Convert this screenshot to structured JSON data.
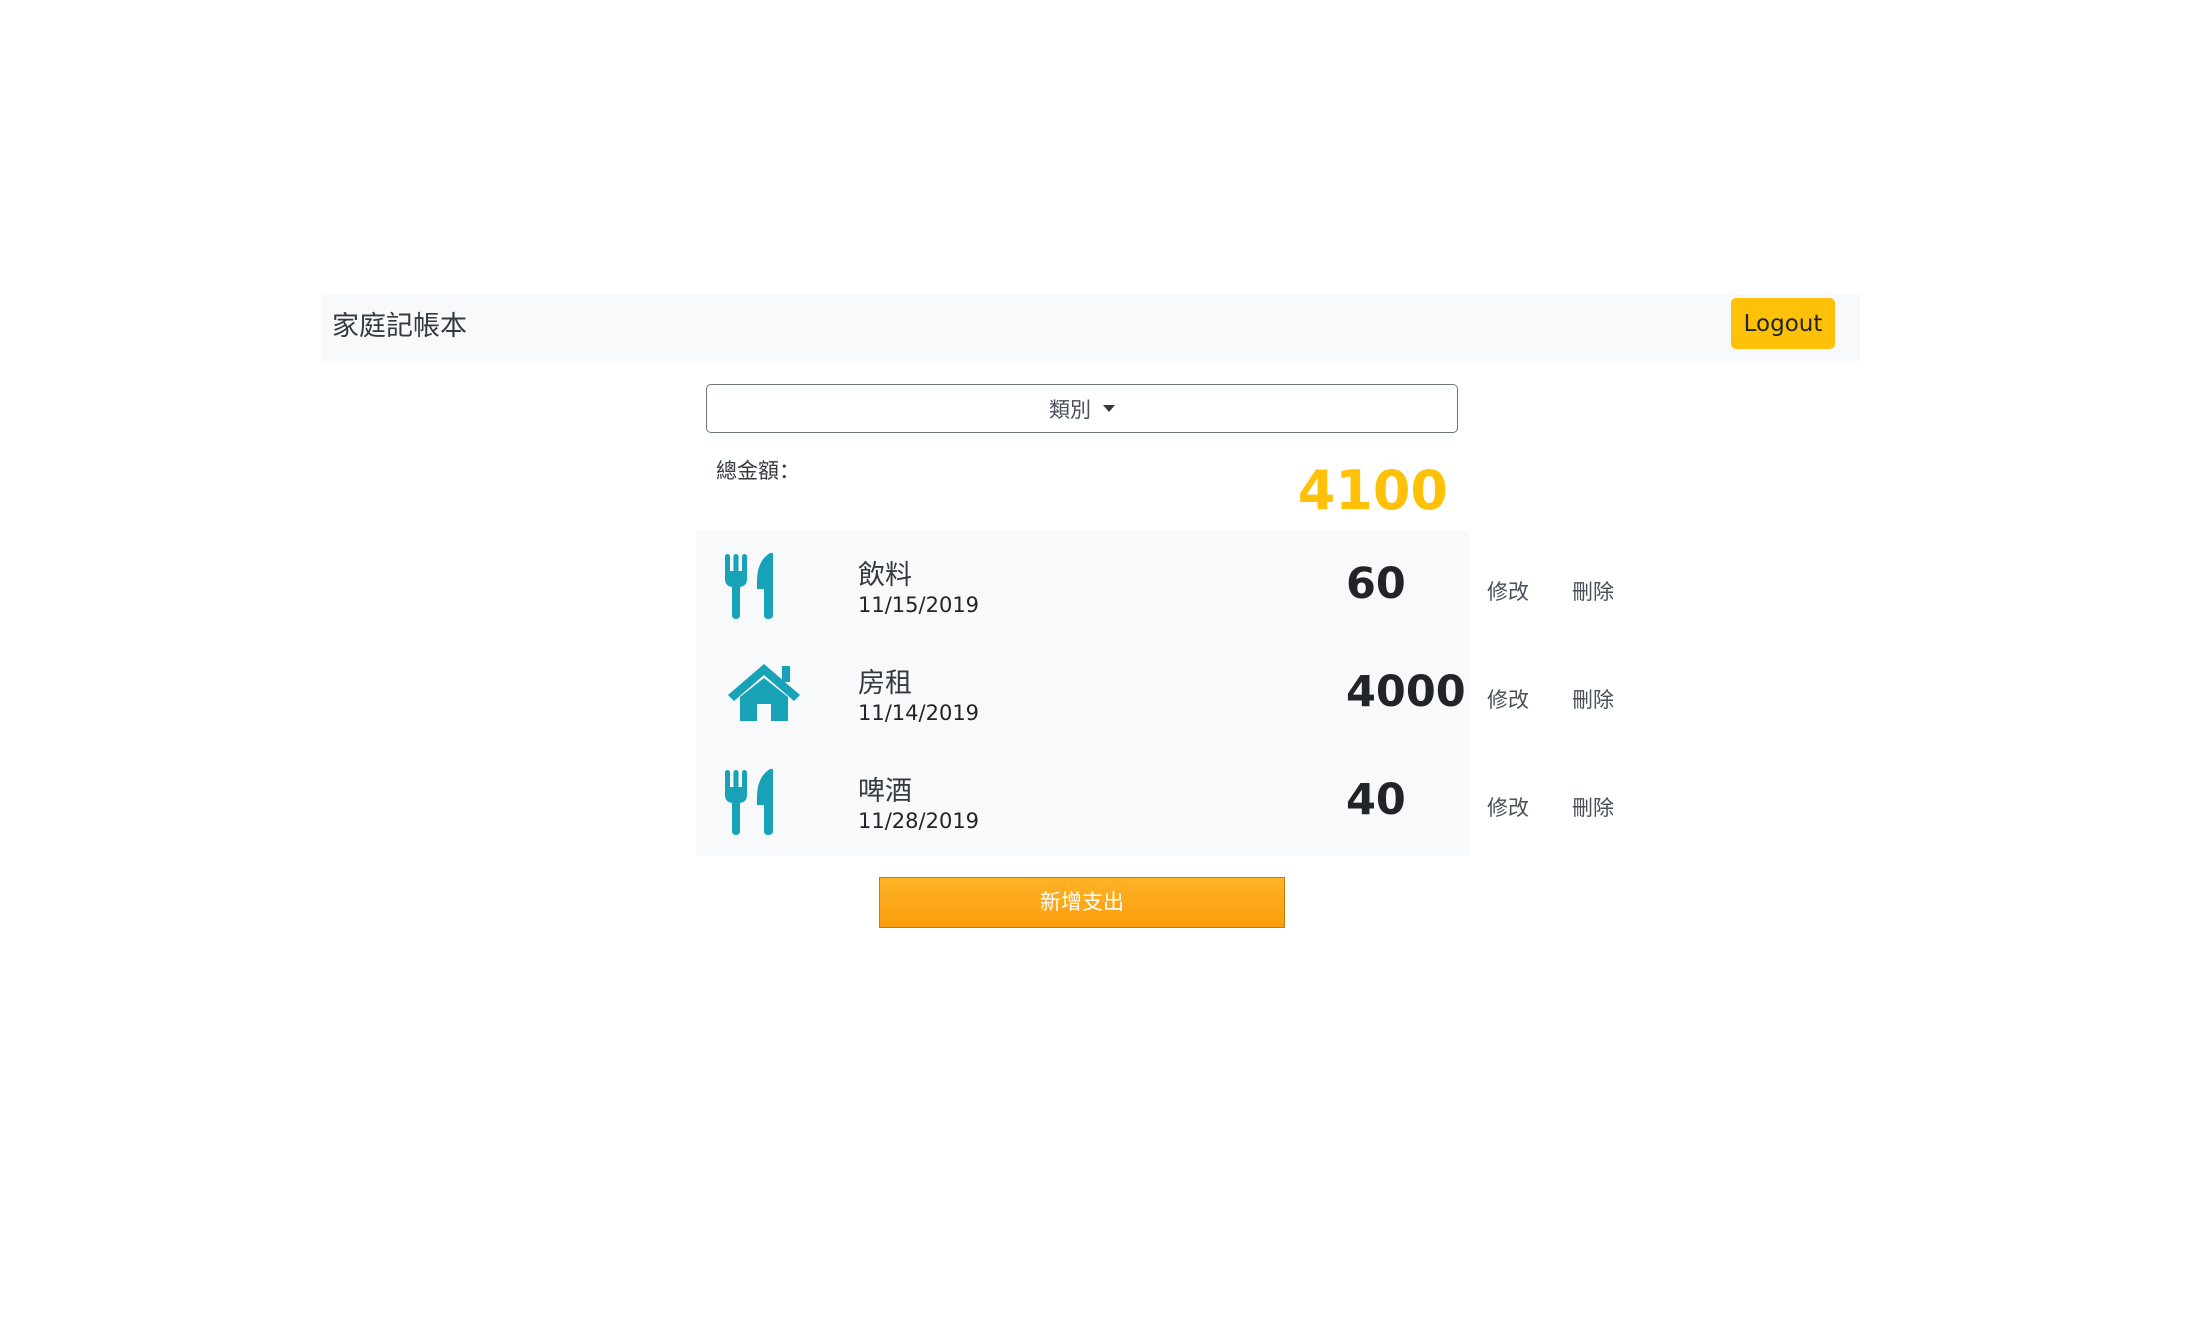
{
  "app": {
    "title": "家庭記帳本",
    "logout_label": "Logout"
  },
  "filter": {
    "category_label": "類別"
  },
  "summary": {
    "total_label": "總金額：",
    "total_amount": "4100"
  },
  "expenses": [
    {
      "icon": "utensils-icon",
      "title": "飲料",
      "date": "11/15/2019",
      "amount": "60",
      "edit_label": "修改",
      "delete_label": "刪除"
    },
    {
      "icon": "home-icon",
      "title": "房租",
      "date": "11/14/2019",
      "amount": "4000",
      "edit_label": "修改",
      "delete_label": "刪除"
    },
    {
      "icon": "utensils-icon",
      "title": "啤酒",
      "date": "11/28/2019",
      "amount": "40",
      "edit_label": "修改",
      "delete_label": "刪除"
    }
  ],
  "actions": {
    "add_label": "新增支出"
  },
  "colors": {
    "accent": "#ffc107",
    "icon": "#17a2b8",
    "add_button": "#ffa91a"
  }
}
